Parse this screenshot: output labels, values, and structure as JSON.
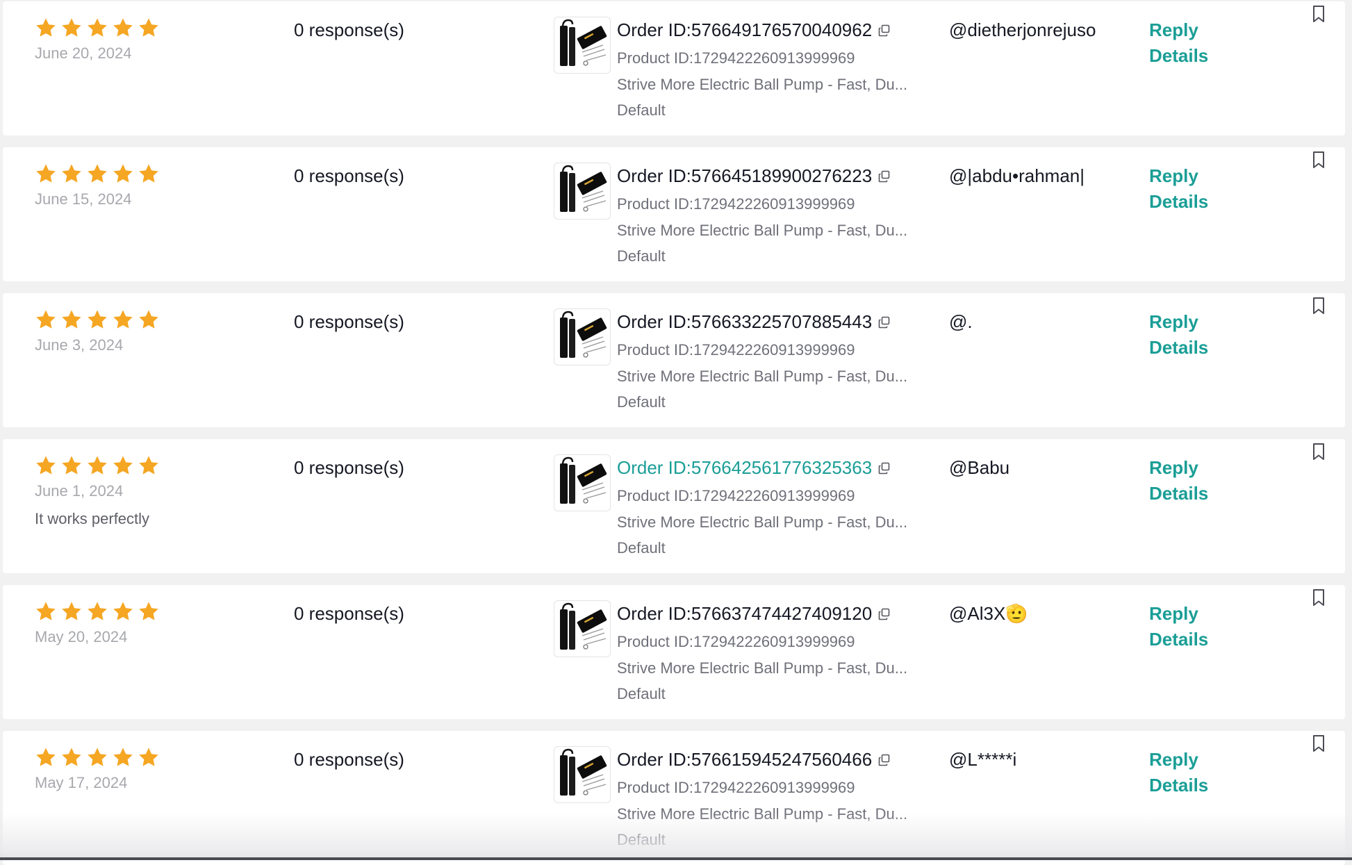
{
  "colors": {
    "star": "#F5A623",
    "link": "#1A9E96",
    "date": "#A7A8AD",
    "secondary_text": "#6F7079"
  },
  "icons": {
    "rating": "star-icon",
    "copy": "copy-icon",
    "bookmark": "bookmark-icon",
    "product": "product-thumbnail"
  },
  "reviews": [
    {
      "rating": 5,
      "date": "June 20, 2024",
      "comment": "",
      "responses": "0 response(s)",
      "order_id": "Order ID:576649176570040962",
      "order_id_active": false,
      "product_id": "Product ID:1729422260913999969",
      "product_name": "Strive More Electric Ball Pump - Fast, Du...",
      "variant": "Default",
      "buyer": "@dietherjonrejuso",
      "reply_label": "Reply",
      "details_label": "Details"
    },
    {
      "rating": 5,
      "date": "June 15, 2024",
      "comment": "",
      "responses": "0 response(s)",
      "order_id": "Order ID:576645189900276223",
      "order_id_active": false,
      "product_id": "Product ID:1729422260913999969",
      "product_name": "Strive More Electric Ball Pump - Fast, Du...",
      "variant": "Default",
      "buyer": "@|abdu•rahman|",
      "reply_label": "Reply",
      "details_label": "Details"
    },
    {
      "rating": 5,
      "date": "June 3, 2024",
      "comment": "",
      "responses": "0 response(s)",
      "order_id": "Order ID:576633225707885443",
      "order_id_active": false,
      "product_id": "Product ID:1729422260913999969",
      "product_name": "Strive More Electric Ball Pump - Fast, Du...",
      "variant": "Default",
      "buyer": "@.",
      "reply_label": "Reply",
      "details_label": "Details"
    },
    {
      "rating": 5,
      "date": "June 1, 2024",
      "comment": "It works perfectly",
      "responses": "0 response(s)",
      "order_id": "Order ID:576642561776325363",
      "order_id_active": true,
      "product_id": "Product ID:1729422260913999969",
      "product_name": "Strive More Electric Ball Pump - Fast, Du...",
      "variant": "Default",
      "buyer": "@Babu",
      "reply_label": "Reply",
      "details_label": "Details"
    },
    {
      "rating": 5,
      "date": "May 20, 2024",
      "comment": "",
      "responses": "0 response(s)",
      "order_id": "Order ID:576637474427409120",
      "order_id_active": false,
      "product_id": "Product ID:1729422260913999969",
      "product_name": "Strive More Electric Ball Pump - Fast, Du...",
      "variant": "Default",
      "buyer": "@Al3X🫡",
      "reply_label": "Reply",
      "details_label": "Details"
    },
    {
      "rating": 5,
      "date": "May 17, 2024",
      "comment": "",
      "responses": "0 response(s)",
      "order_id": "Order ID:576615945247560466",
      "order_id_active": false,
      "product_id": "Product ID:1729422260913999969",
      "product_name": "Strive More Electric Ball Pump - Fast, Du...",
      "variant": "Default",
      "buyer": "@L*****i",
      "reply_label": "Reply",
      "details_label": "Details"
    }
  ]
}
